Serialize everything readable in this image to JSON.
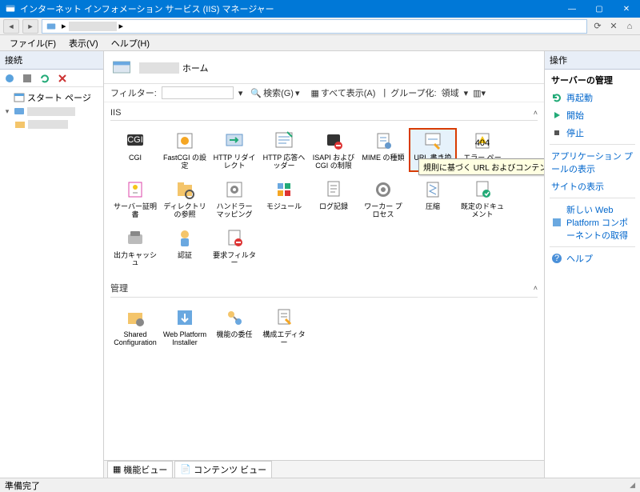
{
  "titlebar": {
    "title": "インターネット インフォメーション サービス (IIS) マネージャー"
  },
  "addressbar": {
    "crumb_sep": "▸"
  },
  "menubar": {
    "file": "ファイル(F)",
    "view": "表示(V)",
    "help": "ヘルプ(H)"
  },
  "connections": {
    "title": "接続",
    "start_page": "スタート ページ",
    "server_node": ""
  },
  "center": {
    "title_suffix": "ホーム",
    "filter_label": "フィルター:",
    "filter_value": "",
    "search_label": "検索(G)",
    "show_all_label": "すべて表示(A)",
    "group_by_label": "グループ化:",
    "group_by_value": "領域",
    "section_iis": "IIS",
    "section_mgmt": "管理",
    "tabs": {
      "features": "機能ビュー",
      "content": "コンテンツ ビュー"
    }
  },
  "features_iis": [
    {
      "name": "cgi",
      "label": "CGI"
    },
    {
      "name": "fastcgi-settings",
      "label": "FastCGI の設定"
    },
    {
      "name": "http-redirect",
      "label": "HTTP リダイレクト"
    },
    {
      "name": "http-response-headers",
      "label": "HTTP 応答ヘッダー"
    },
    {
      "name": "isapi-cgi-restrictions",
      "label": "ISAPI および CGI の制限"
    },
    {
      "name": "mime-types",
      "label": "MIME の種類"
    },
    {
      "name": "url-rewrite",
      "label": "URL 書き換え",
      "selected": true,
      "tooltip": "規則に基づく URL およびコンテンツの書き換え機能を提供します。"
    },
    {
      "name": "error-pages",
      "label": "エラー ページ"
    },
    {
      "name": "server-certificates",
      "label": "サーバー証明書"
    },
    {
      "name": "directory-browsing",
      "label": "ディレクトリの参照"
    },
    {
      "name": "handler-mappings",
      "label": "ハンドラー マッピング"
    },
    {
      "name": "modules",
      "label": "モジュール"
    },
    {
      "name": "logging",
      "label": "ログ記録"
    },
    {
      "name": "worker-processes",
      "label": "ワーカー プロセス"
    },
    {
      "name": "compression",
      "label": "圧縮"
    },
    {
      "name": "default-document",
      "label": "既定のドキュメント"
    },
    {
      "name": "output-caching",
      "label": "出力キャッシュ"
    },
    {
      "name": "authentication",
      "label": "認証"
    },
    {
      "name": "request-filtering",
      "label": "要求フィルター"
    }
  ],
  "features_mgmt": [
    {
      "name": "shared-configuration",
      "label": "Shared Configuration"
    },
    {
      "name": "web-platform-installer",
      "label": "Web Platform Installer"
    },
    {
      "name": "feature-delegation",
      "label": "機能の委任"
    },
    {
      "name": "configuration-editor",
      "label": "構成エディター"
    }
  ],
  "actions": {
    "title": "操作",
    "server_mgmt": "サーバーの管理",
    "restart": "再起動",
    "start": "開始",
    "stop": "停止",
    "view_app_pools": "アプリケーション プールの表示",
    "view_sites": "サイトの表示",
    "get_new_wpc": "新しい Web Platform コンポーネントの取得",
    "help": "ヘルプ"
  },
  "statusbar": {
    "ready": "準備完了"
  },
  "colors": {
    "accent": "#0078d7",
    "highlight_border": "#d83b01"
  }
}
